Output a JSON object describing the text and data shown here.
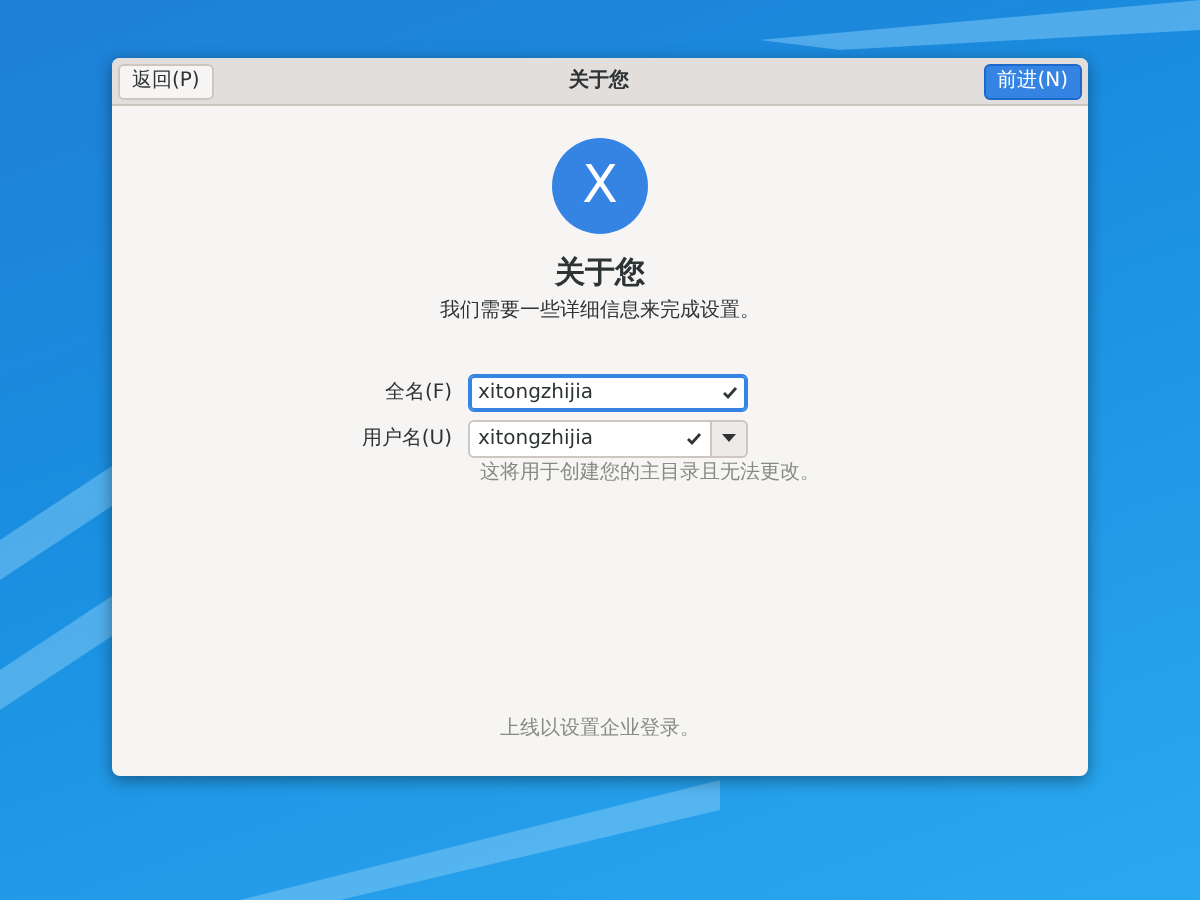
{
  "window": {
    "title": "关于您"
  },
  "back_button": {
    "label": "返回(P)"
  },
  "next_button": {
    "label": "前进(N)"
  },
  "avatar": {
    "letter": "X"
  },
  "heading": "关于您",
  "subtitle": "我们需要一些详细信息来完成设置。",
  "fields": [
    {
      "kind": "entry",
      "label": "全名(F)",
      "value": "xitongzhijia",
      "focused": true
    },
    {
      "kind": "combo",
      "label": "用户名(U)",
      "value": "xitongzhijia",
      "focused": false
    }
  ],
  "hint": "这将用于创建您的主目录且无法更改。",
  "footer_link": "上线以设置企业登录。"
}
